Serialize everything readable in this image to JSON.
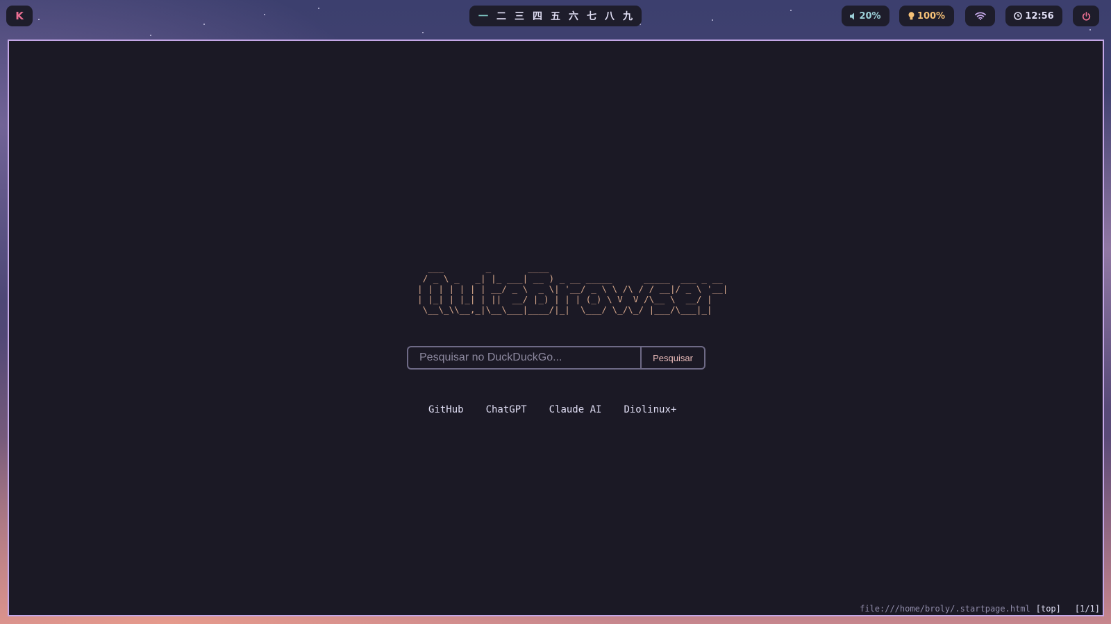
{
  "topbar": {
    "launcher": {
      "label": "K",
      "icon": "launcher-icon"
    },
    "workspaces": [
      "一",
      "二",
      "三",
      "四",
      "五",
      "六",
      "七",
      "八",
      "九"
    ],
    "active_workspace": "一",
    "volume": {
      "icon": "speaker-icon",
      "label": "20%"
    },
    "brightness": {
      "icon": "lightbulb-icon",
      "label": "100%"
    },
    "wifi": {
      "icon": "wifi-icon"
    },
    "clock": {
      "icon": "clock-icon",
      "label": "12:56"
    },
    "power": {
      "icon": "power-icon"
    }
  },
  "startpage": {
    "ascii_logo": "  ___        _       ____\n / _ \\ _   _| |_ ___| __ ) _ __ _____      _____  ___ _ __\n| | | | | | | __/ _ \\  _ \\| '__/ _ \\ \\ /\\ / / __|/ _ \\ '__|\n| |_| | |_| | ||  __/ |_) | | | (_) \\ V  V /\\__ \\  __/ |\n \\__\\_\\\\__,_|\\__\\___|____/|_|  \\___/ \\_/\\_/ |___/\\___|_|",
    "search": {
      "placeholder": "Pesquisar no DuckDuckGo...",
      "value": "",
      "button_label": "Pesquisar"
    },
    "links": [
      "GitHub",
      "ChatGPT",
      "Claude AI",
      "Diolinux+"
    ]
  },
  "statusbar": {
    "url": "file:///home/broly/.startpage.html",
    "scroll_position": "[top]",
    "tab_index": "[1/1]"
  },
  "colors": {
    "window_border": "#c4a7e7",
    "window_bg": "#1b1925",
    "ascii_logo": "#d9a98d",
    "active_workspace": "#7fc8c5",
    "volume": "#9ccfd8",
    "brightness": "#f6c177",
    "power": "#eb6f92"
  }
}
